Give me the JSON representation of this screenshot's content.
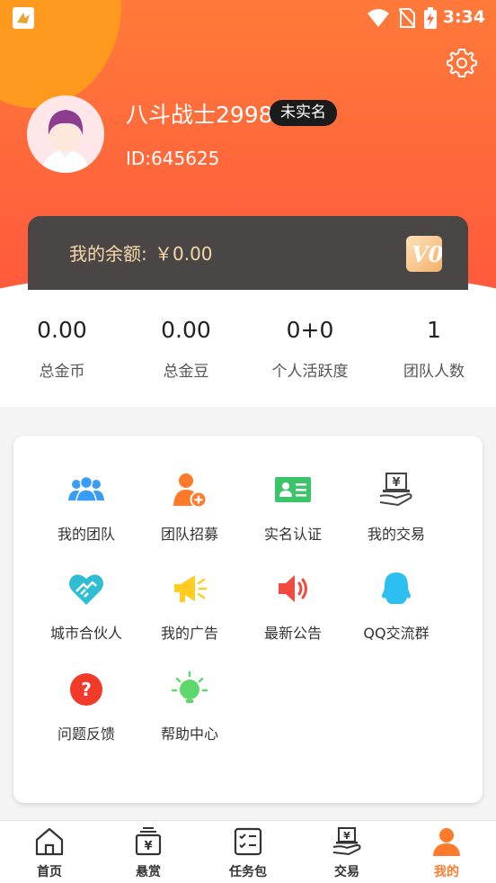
{
  "status_bar": {
    "time": "3:34",
    "icons": [
      "app-badge-icon",
      "wifi-icon",
      "no-sim-icon",
      "battery-charging-icon"
    ]
  },
  "profile": {
    "nickname": "八斗战士2998",
    "verify_badge": "未实名",
    "user_id": "ID:645625",
    "settings_icon": "gear-icon"
  },
  "balance": {
    "label": "我的余额:",
    "value": "￥0.00",
    "vip_level": "V0"
  },
  "stats": [
    {
      "value": "0.00",
      "label": "总金币"
    },
    {
      "value": "0.00",
      "label": "总金豆"
    },
    {
      "value": "0+0",
      "label": "个人活跃度"
    },
    {
      "value": "1",
      "label": "团队人数"
    }
  ],
  "menu": [
    {
      "label": "我的团队",
      "icon": "team-icon"
    },
    {
      "label": "团队招募",
      "icon": "recruit-icon"
    },
    {
      "label": "实名认证",
      "icon": "id-card-icon"
    },
    {
      "label": "我的交易",
      "icon": "trade-icon"
    },
    {
      "label": "城市合伙人",
      "icon": "handshake-icon"
    },
    {
      "label": "我的广告",
      "icon": "megaphone-icon"
    },
    {
      "label": "最新公告",
      "icon": "speaker-icon"
    },
    {
      "label": "QQ交流群",
      "icon": "qq-icon"
    },
    {
      "label": "问题反馈",
      "icon": "question-icon"
    },
    {
      "label": "帮助中心",
      "icon": "lightbulb-icon"
    }
  ],
  "bottom_nav": [
    {
      "label": "首页",
      "icon": "home-icon",
      "active": false
    },
    {
      "label": "悬赏",
      "icon": "reward-icon",
      "active": false
    },
    {
      "label": "任务包",
      "icon": "task-list-icon",
      "active": false
    },
    {
      "label": "交易",
      "icon": "trade-icon",
      "active": false
    },
    {
      "label": "我的",
      "icon": "user-icon",
      "active": true
    }
  ],
  "colors": {
    "header_orange": "#ff6a3a",
    "header_blob": "#ff9a1e",
    "balance_card": "#4a4646",
    "balance_text": "#f6d8a8",
    "nav_active": "#ff7a2a",
    "team_blue": "#3a9df5",
    "recruit_orange": "#ff7a2a",
    "id_green": "#3cc46a",
    "megaphone_yellow": "#ffcc22",
    "speaker_red": "#f04b3e",
    "qq_cyan": "#2dbff0",
    "feedback_red": "#f23a2a",
    "bulb_green": "#5ed86a"
  }
}
